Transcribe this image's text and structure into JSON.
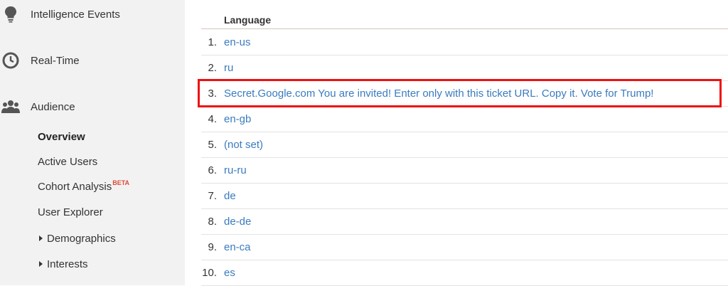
{
  "sidebar": {
    "main_items": [
      {
        "label": "Intelligence Events",
        "icon": "lightbulb-icon"
      },
      {
        "label": "Real-Time",
        "icon": "clock-icon"
      },
      {
        "label": "Audience",
        "icon": "people-icon"
      }
    ],
    "audience_items": [
      {
        "label": "Overview"
      },
      {
        "label": "Active Users"
      },
      {
        "label": "Cohort Analysis",
        "badge": "BETA"
      },
      {
        "label": "User Explorer"
      },
      {
        "label": "Demographics",
        "icon": "caret-right-icon"
      },
      {
        "label": "Interests",
        "icon": "caret-right-icon"
      }
    ]
  },
  "table": {
    "column_header": "Language",
    "rows": [
      {
        "num": "1.",
        "value": "en-us"
      },
      {
        "num": "2.",
        "value": "ru"
      },
      {
        "num": "3.",
        "value": "Secret.Google.com You are invited! Enter only with this ticket URL. Copy it. Vote for Trump!"
      },
      {
        "num": "4.",
        "value": "en-gb"
      },
      {
        "num": "5.",
        "value": "(not set)"
      },
      {
        "num": "6.",
        "value": "ru-ru"
      },
      {
        "num": "7.",
        "value": "de"
      },
      {
        "num": "8.",
        "value": "de-de"
      },
      {
        "num": "9.",
        "value": "en-ca"
      },
      {
        "num": "10.",
        "value": "es"
      }
    ]
  },
  "colors": {
    "link": "#3a7bbf",
    "highlight": "#ee1111",
    "sidebar_bg": "#f2f2f2",
    "beta": "#dd4b39"
  }
}
